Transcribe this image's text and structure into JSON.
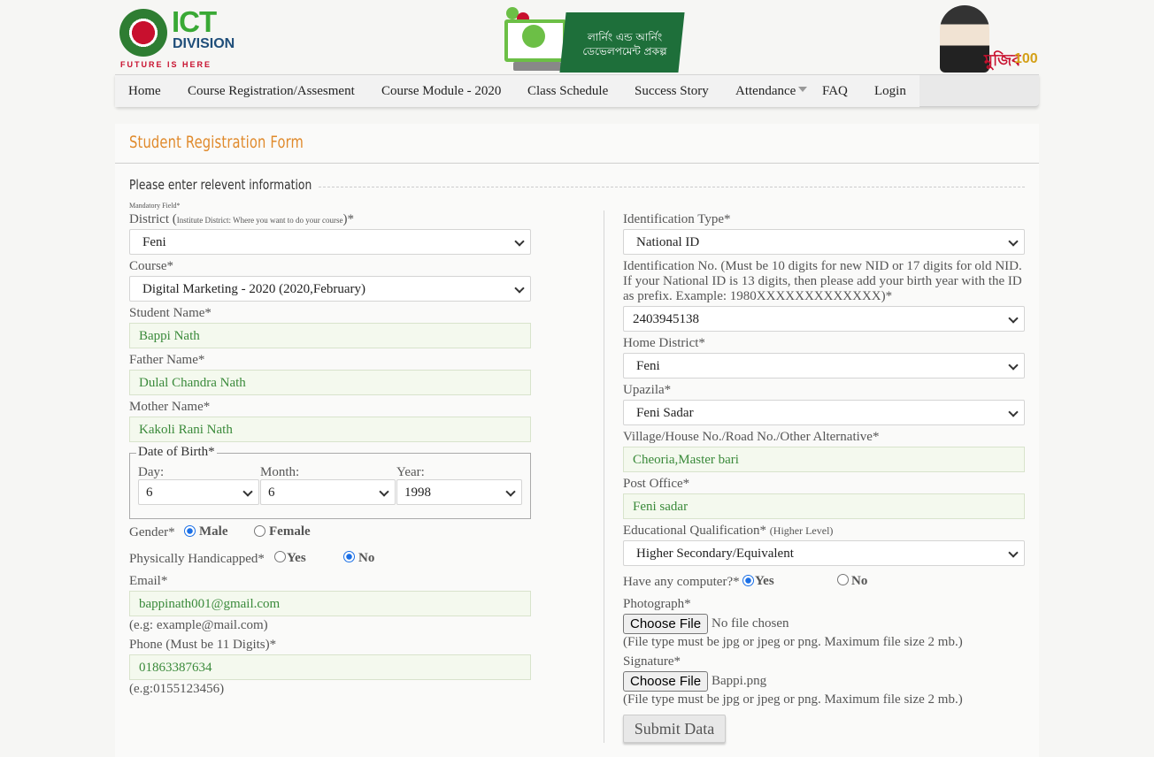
{
  "header": {
    "ict_title": "ICT",
    "ict_subtitle": "DIVISION",
    "ict_tagline": "FUTURE IS HERE",
    "project_line1": "লার্নিং এন্ড আর্নিং",
    "project_line2": "ডেভেলপমেন্ট প্রকল্প",
    "mujib_label": "মুজিব",
    "mujib_years": "100"
  },
  "nav": {
    "items": [
      {
        "label": "Home"
      },
      {
        "label": "Course Registration/Assesment"
      },
      {
        "label": "Course Module - 2020"
      },
      {
        "label": "Class Schedule"
      },
      {
        "label": "Success Story"
      },
      {
        "label": "Attendance"
      },
      {
        "label": "FAQ"
      },
      {
        "label": "Login"
      }
    ]
  },
  "form": {
    "title": "Student Registration Form",
    "legend": "Please enter relevent information",
    "mandatory_note": "Mandatory Field*",
    "district": {
      "label_main": "District (",
      "label_small": "Institute District: Where you want to do your course",
      "label_end": ")*",
      "value": "Feni"
    },
    "course": {
      "label": "Course*",
      "value": "Digital Marketing - 2020 (2020,February)"
    },
    "student_name": {
      "label": "Student Name*",
      "value": "Bappi Nath"
    },
    "father_name": {
      "label": "Father Name*",
      "value": "Dulal Chandra Nath"
    },
    "mother_name": {
      "label": "Mother Name*",
      "value": "Kakoli Rani Nath"
    },
    "dob": {
      "legend": "Date of Birth*",
      "day_label": "Day:",
      "day_value": "6",
      "month_label": "Month:",
      "month_value": "6",
      "year_label": "Year:",
      "year_value": "1998"
    },
    "gender": {
      "label": "Gender*",
      "options": [
        "Male",
        "Female"
      ],
      "selected": "Male"
    },
    "handicapped": {
      "label": "Physically Handicapped*",
      "options": [
        "Yes",
        "No"
      ],
      "selected": "No"
    },
    "email": {
      "label": "Email*",
      "value": "bappinath001@gmail.com",
      "hint": "(e.g: example@mail.com)"
    },
    "phone": {
      "label": "Phone (Must be 11 Digits)*",
      "value": "01863387634",
      "hint": "(e.g:0155123456)"
    },
    "id_type": {
      "label": "Identification Type*",
      "value": "National ID"
    },
    "id_no": {
      "label_line1": "Identification No. (Must be 10 digits for new NID or 17 digits for old NID.",
      "label_line2": "If your National ID is 13 digits, then please add your birth year with the ID",
      "label_line3": "as prefix. Example: 1980XXXXXXXXXXXXX)*",
      "value": "2403945138"
    },
    "home_district": {
      "label": "Home District*",
      "value": "Feni"
    },
    "upazila": {
      "label": "Upazila*",
      "value": "Feni Sadar"
    },
    "village": {
      "label": "Village/House No./Road No./Other Alternative*",
      "value": "Cheoria,Master bari"
    },
    "post_office": {
      "label": "Post Office*",
      "value": "Feni sadar"
    },
    "education": {
      "label_main": "Educational Qualification*",
      "label_small": "(Higher Level)",
      "value": "Higher Secondary/Equivalent"
    },
    "computer": {
      "label": "Have any computer?*",
      "options": [
        "Yes",
        "No"
      ],
      "selected": "Yes"
    },
    "photograph": {
      "label": "Photograph*",
      "button": "Choose File",
      "file": "No file chosen",
      "hint": "(File type must be jpg or jpeg or png. Maximum file size 2 mb.)"
    },
    "signature": {
      "label": "Signature*",
      "button": "Choose File",
      "file": "Bappi.png",
      "hint": "(File type must be jpg or jpeg or png. Maximum file size 2 mb.)"
    },
    "submit": "Submit Data"
  }
}
